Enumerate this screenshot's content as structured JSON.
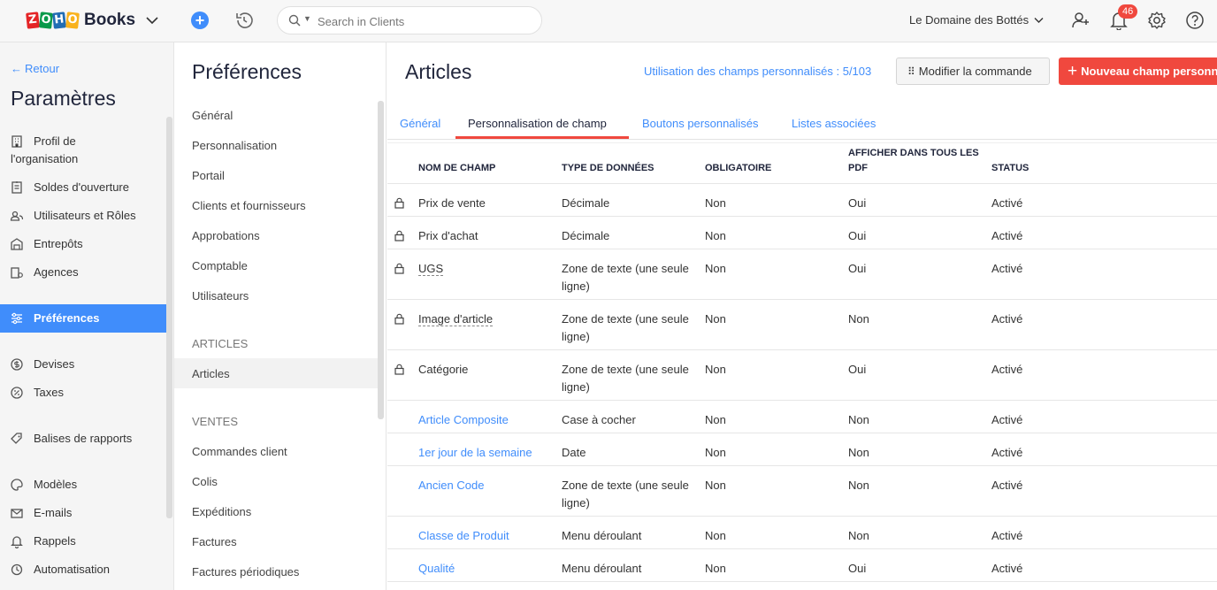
{
  "topbar": {
    "brand_letters": [
      "Z",
      "O",
      "H",
      "O"
    ],
    "brand_colors": [
      "#e42527",
      "#089949",
      "#226db4",
      "#f9b21d"
    ],
    "brand_name": "Books",
    "search_placeholder": "Search in Clients",
    "org_name": "Le Domaine des Bottés",
    "notifications_count": "46"
  },
  "sidebar": {
    "back_label": "Retour",
    "title": "Paramètres",
    "items": [
      {
        "label": "Profil de",
        "label2": "l'organisation",
        "icon": "building-icon"
      },
      {
        "label": "Soldes d'ouverture",
        "icon": "ledger-icon"
      },
      {
        "label": "Utilisateurs et Rôles",
        "icon": "users-icon"
      },
      {
        "label": "Entrepôts",
        "icon": "warehouse-icon"
      },
      {
        "label": "Agences",
        "icon": "branch-icon"
      },
      {
        "label": "Préférences",
        "icon": "sliders-icon",
        "active": true
      },
      {
        "label": "Devises",
        "icon": "currency-icon"
      },
      {
        "label": "Taxes",
        "icon": "percent-icon"
      },
      {
        "label": "Balises de rapports",
        "icon": "tag-icon"
      },
      {
        "label": "Modèles",
        "icon": "palette-icon"
      },
      {
        "label": "E-mails",
        "icon": "mail-icon"
      },
      {
        "label": "Rappels",
        "icon": "bell-icon"
      },
      {
        "label": "Automatisation",
        "icon": "automation-icon"
      }
    ]
  },
  "preferences": {
    "title": "Préférences",
    "general_items": [
      "Général",
      "Personnalisation",
      "Portail",
      "Clients et fournisseurs",
      "Approbations",
      "Comptable",
      "Utilisateurs"
    ],
    "section_articles": "ARTICLES",
    "articles_item": "Articles",
    "section_ventes": "VENTES",
    "ventes_items": [
      "Commandes client",
      "Colis",
      "Expéditions",
      "Factures",
      "Factures périodiques"
    ]
  },
  "main": {
    "title": "Articles",
    "usage": "Utilisation des champs personnalisés : 5/103",
    "modify_button": "Modifier la commande",
    "new_button": "Nouveau champ personnalisé",
    "tabs": [
      "Général",
      "Personnalisation de champ",
      "Boutons personnalisés",
      "Listes associées"
    ],
    "columns": {
      "name": "NOM DE CHAMP",
      "type": "TYPE DE DONNÉES",
      "required": "OBLIGATOIRE",
      "pdf": "AFFICHER DANS TOUS LES PDF",
      "status": "STATUS"
    },
    "rows": [
      {
        "name": "Prix de vente",
        "type": "Décimale",
        "required": "Non",
        "pdf": "Oui",
        "status": "Activé",
        "locked": true
      },
      {
        "name": "Prix d'achat",
        "type": "Décimale",
        "required": "Non",
        "pdf": "Oui",
        "status": "Activé",
        "locked": true
      },
      {
        "name": "UGS",
        "type": "Zone de texte (une seule ligne)",
        "required": "Non",
        "pdf": "Oui",
        "status": "Activé",
        "locked": true,
        "dashed": true
      },
      {
        "name": "Image d'article",
        "type": "Zone de texte (une seule ligne)",
        "required": "Non",
        "pdf": "Non",
        "status": "Activé",
        "locked": true,
        "dashed": true
      },
      {
        "name": "Catégorie",
        "type": "Zone de texte (une seule ligne)",
        "required": "Non",
        "pdf": "Oui",
        "status": "Activé",
        "locked": true
      },
      {
        "name": "Article Composite",
        "type": "Case à cocher",
        "required": "Non",
        "pdf": "Non",
        "status": "Activé",
        "link": true
      },
      {
        "name": "1er jour de la semaine",
        "type": "Date",
        "required": "Non",
        "pdf": "Non",
        "status": "Activé",
        "link": true
      },
      {
        "name": "Ancien Code",
        "type": "Zone de texte (une seule ligne)",
        "required": "Non",
        "pdf": "Non",
        "status": "Activé",
        "link": true
      },
      {
        "name": "Classe de Produit",
        "type": "Menu déroulant",
        "required": "Non",
        "pdf": "Non",
        "status": "Activé",
        "link": true
      },
      {
        "name": "Qualité",
        "type": "Menu déroulant",
        "required": "Non",
        "pdf": "Oui",
        "status": "Activé",
        "link": true
      }
    ]
  }
}
